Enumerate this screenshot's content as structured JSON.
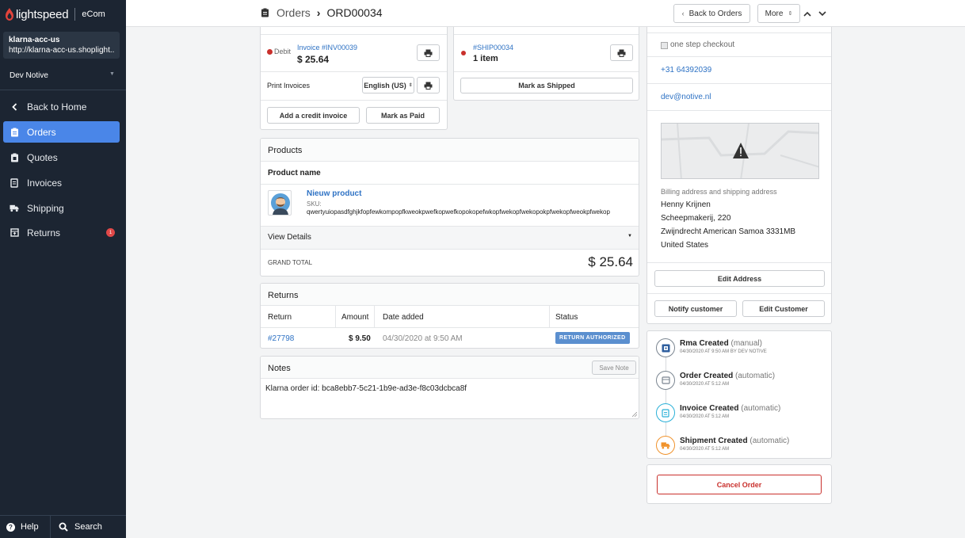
{
  "brand": {
    "name": "lightspeed",
    "product": "eCom"
  },
  "account": {
    "name": "klarna-acc-us",
    "url": "http://klarna-acc-us.shoplight..."
  },
  "store": {
    "name": "Dev Notive"
  },
  "nav": {
    "back_home": "Back to Home",
    "orders": "Orders",
    "quotes": "Quotes",
    "invoices": "Invoices",
    "shipping": "Shipping",
    "returns": "Returns",
    "returns_badge": "1"
  },
  "bottom": {
    "help": "Help",
    "search": "Search"
  },
  "header": {
    "section": "Orders",
    "order_id": "ORD00034",
    "back_orders": "Back to Orders",
    "more": "More"
  },
  "invoice": {
    "status": "Debit",
    "link": "Invoice #INV00039",
    "amount": "$ 25.64",
    "print_label": "Print Invoices",
    "language": "English (US)",
    "add_credit": "Add a credit invoice",
    "mark_paid": "Mark as Paid"
  },
  "shipment": {
    "link": "#SHIP00034",
    "items": "1 item",
    "mark_shipped": "Mark as Shipped"
  },
  "products": {
    "title": "Products",
    "column": "Product name",
    "name": "Nieuw product",
    "sku_label": "SKU:",
    "sku": "qwertyuiopasdfghjkfopfewkompopfkweokpwefkopwefkopokopefwkopfwekopfwekopokpfwekopfweokpfwekop",
    "view_details": "View Details",
    "grand_total_label": "GRAND TOTAL",
    "grand_total": "$ 25.64"
  },
  "returns": {
    "title": "Returns",
    "columns": [
      "Return",
      "Amount",
      "Date added",
      "Status"
    ],
    "row": {
      "id": "#27798",
      "amount": "$ 9.50",
      "date": "04/30/2020 at 9:50 AM",
      "status": "RETURN AUTHORIZED"
    }
  },
  "notes": {
    "title": "Notes",
    "save": "Save Note",
    "text": "Klarna order id: bca8ebb7-5c21-1b9e-ad3e-f8c03dcbca8f"
  },
  "customer": {
    "checkout": "one step checkout",
    "phone": "+31 64392039",
    "email": "dev@notive.nl",
    "address_label": "Billing address and shipping address",
    "address_lines": [
      "Henny Krijnen",
      "Scheepmakerij, 220",
      "Zwijndrecht American Samoa 3331MB",
      "United States"
    ],
    "edit_address": "Edit Address",
    "notify": "Notify customer",
    "edit_customer": "Edit Customer"
  },
  "timeline": [
    {
      "title": "Rma Created",
      "mode": "(manual)",
      "meta": "04/30/2020 AT 9:50 AM BY DEV NOTIVE",
      "color": "#7a8590"
    },
    {
      "title": "Order Created",
      "mode": "(automatic)",
      "meta": "04/30/2020 AT 5:12 AM",
      "color": "#7a8590"
    },
    {
      "title": "Invoice Created",
      "mode": "(automatic)",
      "meta": "04/30/2020 AT 5:12 AM",
      "color": "#2ab0d8"
    },
    {
      "title": "Shipment Created",
      "mode": "(automatic)",
      "meta": "04/30/2020 AT 5:12 AM",
      "color": "#f0922b"
    }
  ],
  "cancel": "Cancel Order",
  "colors": {
    "accent": "#4a86e8",
    "danger": "#c9302c",
    "sidebar": "#1c2532",
    "status_badge": "#5b8fcf"
  }
}
